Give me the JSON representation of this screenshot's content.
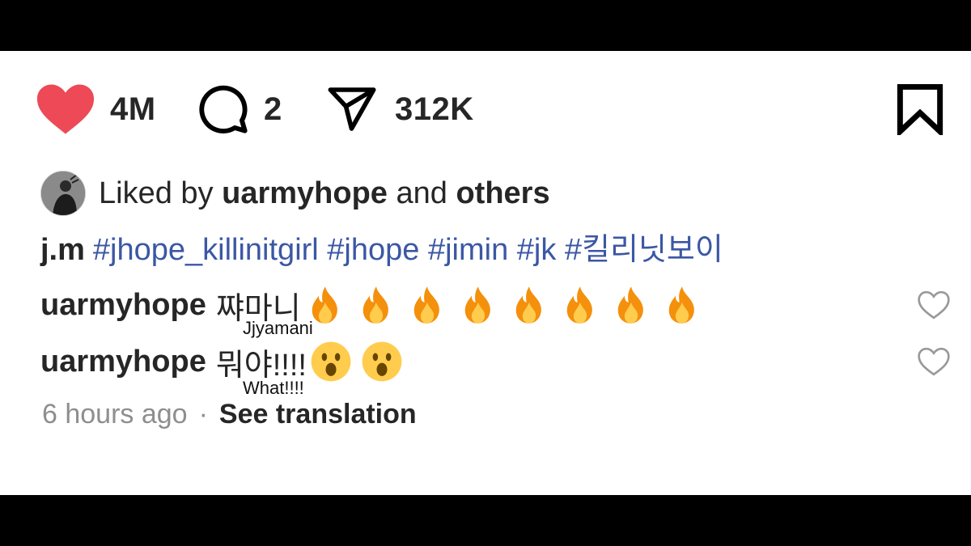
{
  "actions": {
    "likes": "4M",
    "comments": "2",
    "shares": "312K",
    "like_icon": "heart-filled-icon",
    "comment_icon": "comment-bubble-icon",
    "share_icon": "paper-plane-icon",
    "save_icon": "bookmark-icon",
    "like_color": "#ed4956"
  },
  "liked_by": {
    "prefix": "Liked by",
    "user": "uarmyhope",
    "middle": "and",
    "others": "others"
  },
  "caption": {
    "user": "j.m",
    "hashtags": "#jhope_killinitgirl #jhope #jimin #jk #킬리닛보이",
    "hashtag_color": "#3b57a5"
  },
  "comments": [
    {
      "user": "uarmyhope",
      "text": "쨔마니",
      "emoji": "fire-emoji",
      "emoji_count": 8,
      "translation": "Jjyamani"
    },
    {
      "user": "uarmyhope",
      "text": "뭐야!!!!",
      "emoji": "astonished-face-emoji",
      "emoji_count": 2,
      "translation": "What!!!!"
    }
  ],
  "meta": {
    "time": "6 hours ago",
    "separator": "·",
    "see_translation": "See translation"
  }
}
